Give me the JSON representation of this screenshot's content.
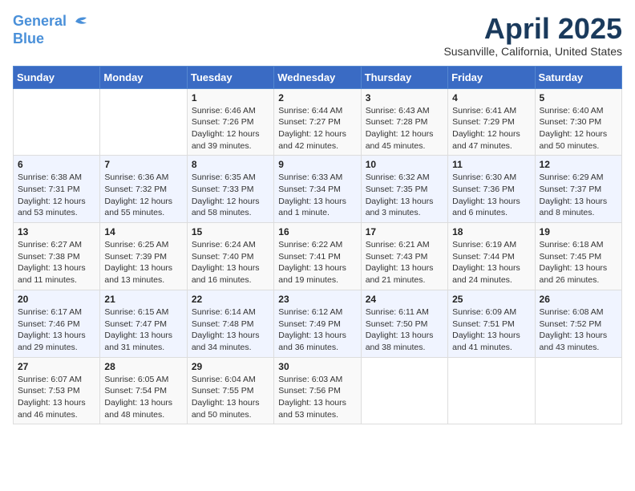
{
  "header": {
    "logo_line1": "General",
    "logo_line2": "Blue",
    "month": "April 2025",
    "location": "Susanville, California, United States"
  },
  "weekdays": [
    "Sunday",
    "Monday",
    "Tuesday",
    "Wednesday",
    "Thursday",
    "Friday",
    "Saturday"
  ],
  "weeks": [
    [
      {
        "day": "",
        "info": ""
      },
      {
        "day": "",
        "info": ""
      },
      {
        "day": "1",
        "info": "Sunrise: 6:46 AM\nSunset: 7:26 PM\nDaylight: 12 hours\nand 39 minutes."
      },
      {
        "day": "2",
        "info": "Sunrise: 6:44 AM\nSunset: 7:27 PM\nDaylight: 12 hours\nand 42 minutes."
      },
      {
        "day": "3",
        "info": "Sunrise: 6:43 AM\nSunset: 7:28 PM\nDaylight: 12 hours\nand 45 minutes."
      },
      {
        "day": "4",
        "info": "Sunrise: 6:41 AM\nSunset: 7:29 PM\nDaylight: 12 hours\nand 47 minutes."
      },
      {
        "day": "5",
        "info": "Sunrise: 6:40 AM\nSunset: 7:30 PM\nDaylight: 12 hours\nand 50 minutes."
      }
    ],
    [
      {
        "day": "6",
        "info": "Sunrise: 6:38 AM\nSunset: 7:31 PM\nDaylight: 12 hours\nand 53 minutes."
      },
      {
        "day": "7",
        "info": "Sunrise: 6:36 AM\nSunset: 7:32 PM\nDaylight: 12 hours\nand 55 minutes."
      },
      {
        "day": "8",
        "info": "Sunrise: 6:35 AM\nSunset: 7:33 PM\nDaylight: 12 hours\nand 58 minutes."
      },
      {
        "day": "9",
        "info": "Sunrise: 6:33 AM\nSunset: 7:34 PM\nDaylight: 13 hours\nand 1 minute."
      },
      {
        "day": "10",
        "info": "Sunrise: 6:32 AM\nSunset: 7:35 PM\nDaylight: 13 hours\nand 3 minutes."
      },
      {
        "day": "11",
        "info": "Sunrise: 6:30 AM\nSunset: 7:36 PM\nDaylight: 13 hours\nand 6 minutes."
      },
      {
        "day": "12",
        "info": "Sunrise: 6:29 AM\nSunset: 7:37 PM\nDaylight: 13 hours\nand 8 minutes."
      }
    ],
    [
      {
        "day": "13",
        "info": "Sunrise: 6:27 AM\nSunset: 7:38 PM\nDaylight: 13 hours\nand 11 minutes."
      },
      {
        "day": "14",
        "info": "Sunrise: 6:25 AM\nSunset: 7:39 PM\nDaylight: 13 hours\nand 13 minutes."
      },
      {
        "day": "15",
        "info": "Sunrise: 6:24 AM\nSunset: 7:40 PM\nDaylight: 13 hours\nand 16 minutes."
      },
      {
        "day": "16",
        "info": "Sunrise: 6:22 AM\nSunset: 7:41 PM\nDaylight: 13 hours\nand 19 minutes."
      },
      {
        "day": "17",
        "info": "Sunrise: 6:21 AM\nSunset: 7:43 PM\nDaylight: 13 hours\nand 21 minutes."
      },
      {
        "day": "18",
        "info": "Sunrise: 6:19 AM\nSunset: 7:44 PM\nDaylight: 13 hours\nand 24 minutes."
      },
      {
        "day": "19",
        "info": "Sunrise: 6:18 AM\nSunset: 7:45 PM\nDaylight: 13 hours\nand 26 minutes."
      }
    ],
    [
      {
        "day": "20",
        "info": "Sunrise: 6:17 AM\nSunset: 7:46 PM\nDaylight: 13 hours\nand 29 minutes."
      },
      {
        "day": "21",
        "info": "Sunrise: 6:15 AM\nSunset: 7:47 PM\nDaylight: 13 hours\nand 31 minutes."
      },
      {
        "day": "22",
        "info": "Sunrise: 6:14 AM\nSunset: 7:48 PM\nDaylight: 13 hours\nand 34 minutes."
      },
      {
        "day": "23",
        "info": "Sunrise: 6:12 AM\nSunset: 7:49 PM\nDaylight: 13 hours\nand 36 minutes."
      },
      {
        "day": "24",
        "info": "Sunrise: 6:11 AM\nSunset: 7:50 PM\nDaylight: 13 hours\nand 38 minutes."
      },
      {
        "day": "25",
        "info": "Sunrise: 6:09 AM\nSunset: 7:51 PM\nDaylight: 13 hours\nand 41 minutes."
      },
      {
        "day": "26",
        "info": "Sunrise: 6:08 AM\nSunset: 7:52 PM\nDaylight: 13 hours\nand 43 minutes."
      }
    ],
    [
      {
        "day": "27",
        "info": "Sunrise: 6:07 AM\nSunset: 7:53 PM\nDaylight: 13 hours\nand 46 minutes."
      },
      {
        "day": "28",
        "info": "Sunrise: 6:05 AM\nSunset: 7:54 PM\nDaylight: 13 hours\nand 48 minutes."
      },
      {
        "day": "29",
        "info": "Sunrise: 6:04 AM\nSunset: 7:55 PM\nDaylight: 13 hours\nand 50 minutes."
      },
      {
        "day": "30",
        "info": "Sunrise: 6:03 AM\nSunset: 7:56 PM\nDaylight: 13 hours\nand 53 minutes."
      },
      {
        "day": "",
        "info": ""
      },
      {
        "day": "",
        "info": ""
      },
      {
        "day": "",
        "info": ""
      }
    ]
  ]
}
